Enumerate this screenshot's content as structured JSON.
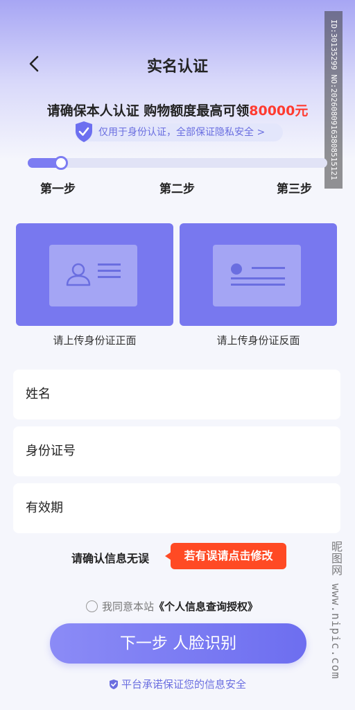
{
  "header": {
    "title": "实名认证"
  },
  "watermark_top": "ID:30135299 NO:20260809163808515121",
  "watermark_side": "昵图网 www.nipic.com",
  "promo": {
    "prefix": "请确保本人认证 购物额度最高可领",
    "amount": "80000元"
  },
  "privacy_notice": "仅用于身份认证，全部保证隐私安全 >",
  "steps": {
    "progress": 0.11,
    "labels": [
      "第一步",
      "第二步",
      "第三步"
    ]
  },
  "upload": {
    "front_label": "请上传身份证正面",
    "back_label": "请上传身份证反面"
  },
  "form": {
    "name_placeholder": "姓名",
    "id_placeholder": "身份证号",
    "validity_placeholder": "有效期"
  },
  "confirm": {
    "text": "请确认信息无误",
    "modify_label": "若有误请点击修改"
  },
  "agreement": {
    "prefix": "我同意本站",
    "link": "《个人信息查询授权》"
  },
  "next_button": "下一步 人脸识别",
  "footer_note": "平台承诺保证您的信息安全",
  "colors": {
    "accent": "#7878ef",
    "warning": "#ff4a24",
    "amount": "#ff3b30"
  }
}
